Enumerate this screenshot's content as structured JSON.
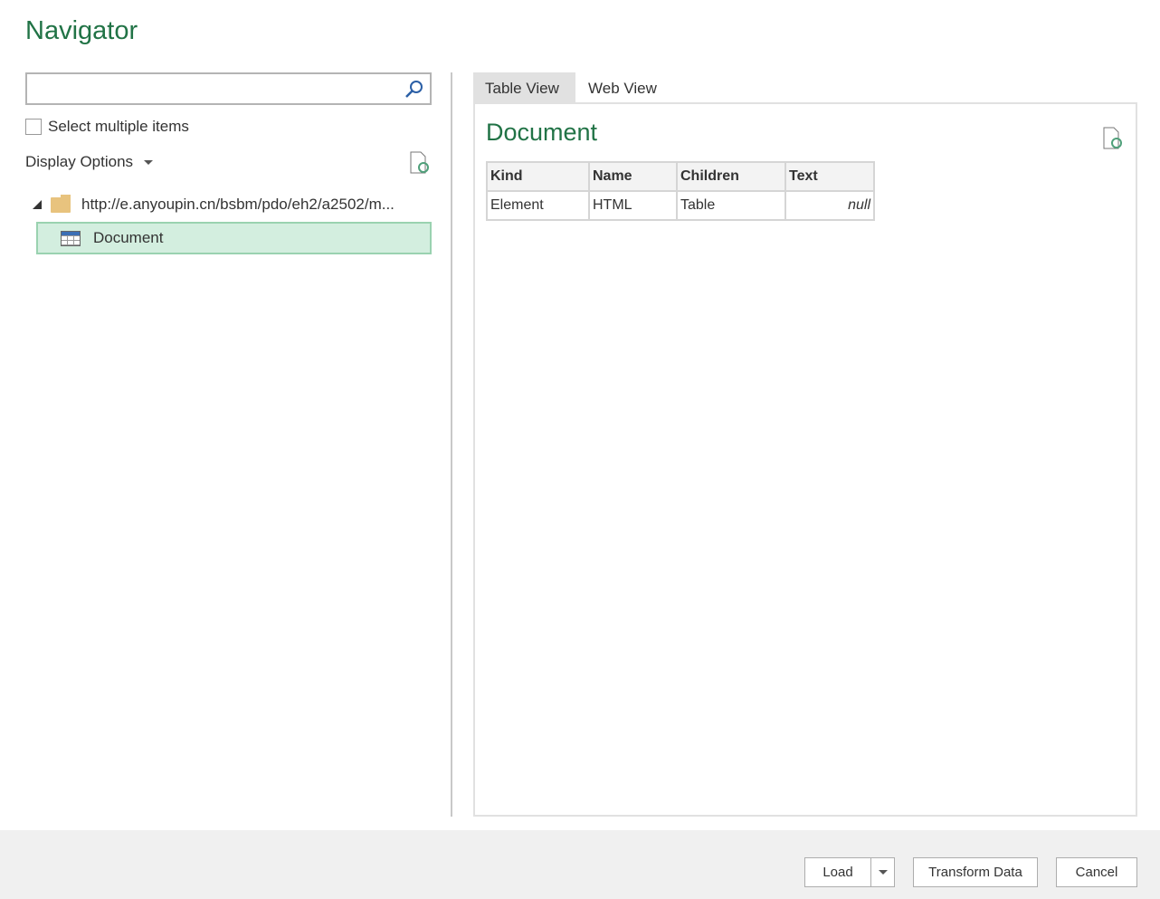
{
  "title": "Navigator",
  "search": {
    "placeholder": ""
  },
  "select_multiple": {
    "label": "Select multiple items",
    "checked": false
  },
  "display_options": "Display Options",
  "tree": {
    "root": "http://e.anyoupin.cn/bsbm/pdo/eh2/a2502/m...",
    "child": "Document"
  },
  "tabs": [
    "Table View",
    "Web View"
  ],
  "preview": {
    "title": "Document",
    "columns": [
      "Kind",
      "Name",
      "Children",
      "Text"
    ],
    "rows": [
      [
        "Element",
        "HTML",
        "Table",
        "null"
      ]
    ]
  },
  "buttons": {
    "load": "Load",
    "transform": "Transform Data",
    "cancel": "Cancel"
  }
}
